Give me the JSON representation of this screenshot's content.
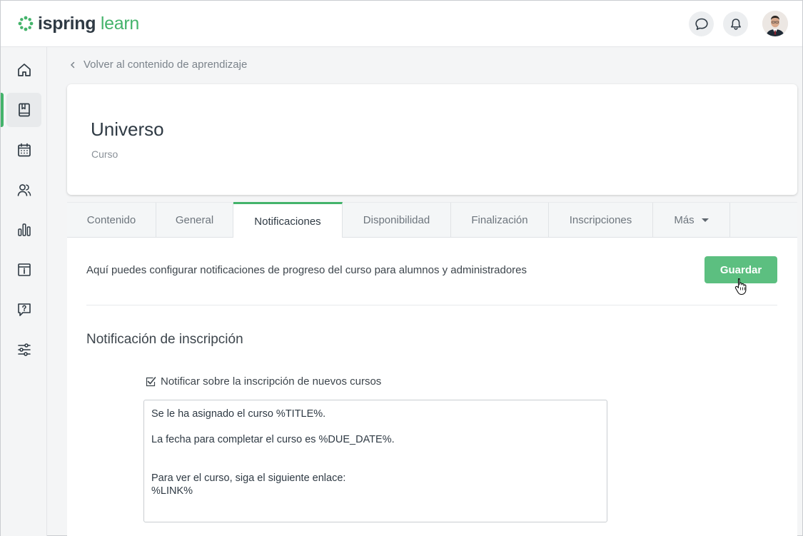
{
  "header": {
    "logo_word1": "ispring",
    "logo_word2": "learn",
    "brand_color": "#44b36b",
    "icons": [
      "chat-icon",
      "bell-icon",
      "user-avatar"
    ]
  },
  "sidebar": {
    "items": [
      {
        "icon": "home-icon"
      },
      {
        "icon": "book-icon",
        "active": true
      },
      {
        "icon": "calendar-icon"
      },
      {
        "icon": "users-icon"
      },
      {
        "icon": "chart-icon"
      },
      {
        "icon": "info-board-icon"
      },
      {
        "icon": "question-icon"
      },
      {
        "icon": "settings-sliders-icon"
      }
    ]
  },
  "breadcrumb": {
    "back_label": "Volver al contenido de aprendizaje"
  },
  "course": {
    "title": "Universo",
    "type": "Curso"
  },
  "tabs": [
    {
      "label": "Contenido"
    },
    {
      "label": "General"
    },
    {
      "label": "Notificaciones",
      "active": true
    },
    {
      "label": "Disponibilidad"
    },
    {
      "label": "Finalización"
    },
    {
      "label": "Inscripciones"
    },
    {
      "label": "Más"
    }
  ],
  "panel": {
    "intro": "Aquí puedes configurar notificaciones de progreso del curso para alumnos y administradores",
    "save_label": "Guardar",
    "section_title": "Notificación de inscripción",
    "checkbox_label": "Notificar sobre la inscripción de nuevos cursos",
    "checkbox_checked": true,
    "message": "Se le ha asignado el curso %TITLE%.\n\nLa fecha para completar el curso es %DUE_DATE%.\n\n\nPara ver el curso, siga el siguiente enlace:\n%LINK%"
  }
}
